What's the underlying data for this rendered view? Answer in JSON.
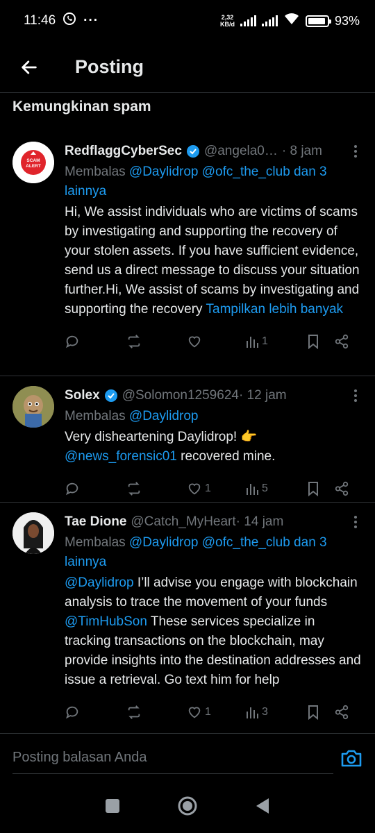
{
  "status": {
    "time": "11:46",
    "netspeed_value": "2,32",
    "netspeed_unit": "KB/d",
    "battery": "93%",
    "battery_level": 0.93
  },
  "header": {
    "title": "Posting",
    "back_icon": "arrow-left-icon"
  },
  "section": {
    "title": "Kemungkinan spam"
  },
  "posts": [
    {
      "name": "RedflaggCyberSec",
      "handle": "@angela0…",
      "time": "· 8 jam",
      "reply_prefix": "Membalas ",
      "reply_users": "@Daylidrop @ofc_the_club dan 3 lainnya",
      "text": "Hi, We assist individuals who are victims of scams by investigating and supporting the recovery of your stolen assets. If you have sufficient evidence, send us a direct message to discuss your situation further.Hi, We assist of scams by investigating and supporting the recovery ",
      "more_link": "Tampilkan lebih banyak",
      "avatar_text": "SCAM ALERT",
      "likes": "",
      "views": "1"
    },
    {
      "name": "Solex",
      "handle": "@Solomon1259624",
      "time": " · 12 jam",
      "reply_prefix": "Membalas ",
      "reply_users": "@Daylidrop",
      "text_part1": "Very disheartening Daylidrop! 👉",
      "mention": "@news_forensic01",
      "text_part2": " recovered mine.",
      "likes": "1",
      "views": "5"
    },
    {
      "name": "Tae Dione",
      "handle": "@Catch_MyHeart",
      "time": " · 14 jam",
      "reply_prefix": "Membalas ",
      "reply_users": "@Daylidrop @ofc_the_club dan 3 lainnya",
      "mention1": "@Daylidrop",
      "text_part1": " I’ll advise you engage with blockchain analysis to trace the movement of your funds ",
      "mention2": "@TimHubSon",
      "text_part2": " These services specialize in tracking transactions on the blockchain, may provide insights into the destination addresses and issue a retrieval. Go text him for help",
      "likes": "1",
      "views": "3"
    }
  ],
  "reply_bar": {
    "placeholder": "Posting balasan Anda"
  },
  "colors": {
    "accent": "#1d9bf0",
    "muted": "#71767b",
    "text": "#e7e9ea",
    "background": "#000000"
  }
}
